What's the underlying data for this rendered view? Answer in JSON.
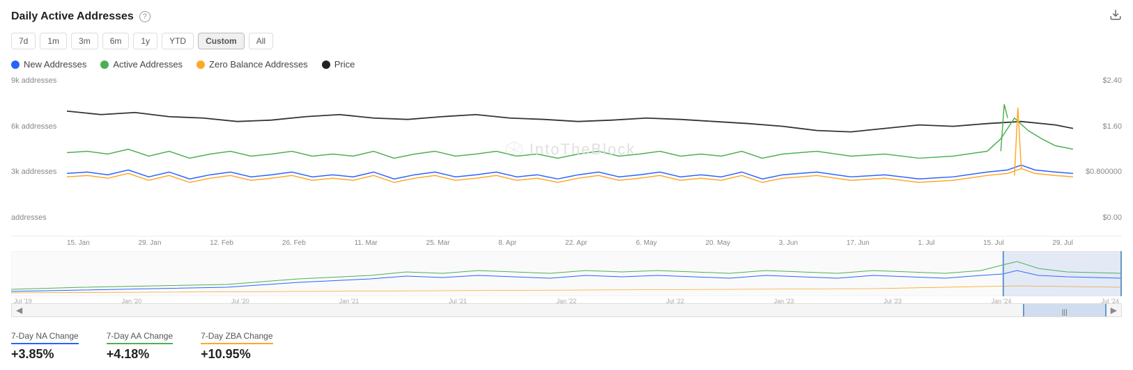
{
  "header": {
    "title": "Daily Active Addresses",
    "help_label": "?",
    "download_icon": "⬇"
  },
  "timeFilters": {
    "buttons": [
      "7d",
      "1m",
      "3m",
      "6m",
      "1y",
      "YTD",
      "Custom",
      "All"
    ],
    "active": "Custom"
  },
  "legend": {
    "items": [
      {
        "label": "New Addresses",
        "color": "#2962FF",
        "type": "dot"
      },
      {
        "label": "Active Addresses",
        "color": "#4CAF50",
        "type": "dot"
      },
      {
        "label": "Zero Balance Addresses",
        "color": "#FFA726",
        "type": "dot"
      },
      {
        "label": "Price",
        "color": "#222222",
        "type": "dot"
      }
    ]
  },
  "yAxisLeft": [
    "9k addresses",
    "6k addresses",
    "3k addresses",
    "addresses"
  ],
  "yAxisRight": [
    "$2.40",
    "$1.60",
    "$0.800000",
    "$0.00"
  ],
  "xAxis": [
    "15. Jan",
    "29. Jan",
    "12. Feb",
    "26. Feb",
    "11. Mar",
    "25. Mar",
    "8. Apr",
    "22. Apr",
    "6. May",
    "20. May",
    "3. Jun",
    "17. Jun",
    "1. Jul",
    "15. Jul",
    "29. Jul"
  ],
  "miniXAxis": [
    "Jul '19",
    "Jan '20",
    "Jul '20",
    "Jan '21",
    "Jul '21",
    "Jan '22",
    "Jul '22",
    "Jan '23",
    "Jul '23",
    "Jan '24",
    "Jul '24"
  ],
  "stats": [
    {
      "label": "7-Day NA Change",
      "value": "+3.85%",
      "color": "#2962FF"
    },
    {
      "label": "7-Day AA Change",
      "value": "+4.18%",
      "color": "#4CAF50"
    },
    {
      "label": "7-Day ZBA Change",
      "value": "+10.95%",
      "color": "#FFA726"
    }
  ],
  "watermark": "IntoTheBlock",
  "colors": {
    "new_addresses": "#2962FF",
    "active_addresses": "#4CAF50",
    "zero_balance": "#FFA726",
    "price": "#333333"
  }
}
